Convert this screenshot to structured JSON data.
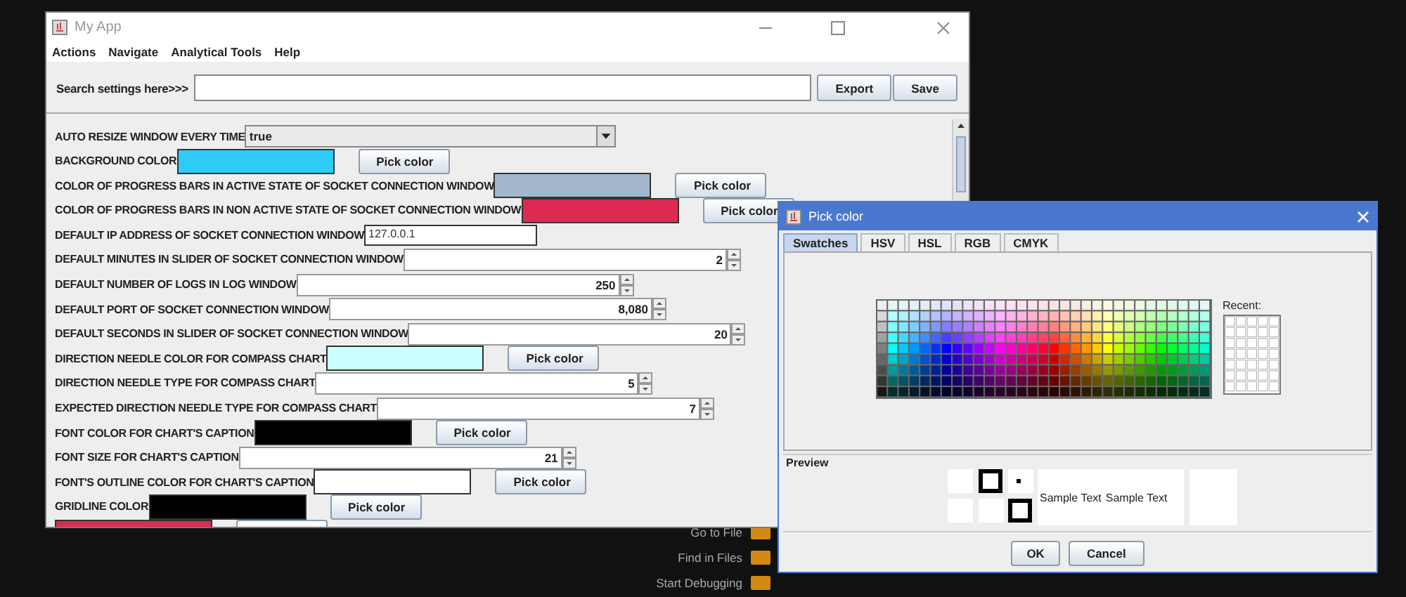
{
  "main_window": {
    "title": "My App",
    "menu": [
      "Actions",
      "Navigate",
      "Analytical Tools",
      "Help"
    ],
    "search_label": "Search settings here>>>",
    "buttons": [
      "Export",
      "Save"
    ],
    "settings": [
      {
        "kind": "combo",
        "label": "AUTO RESIZE WINDOW EVERY TIME",
        "value": "true"
      },
      {
        "kind": "color",
        "label": "BACKGROUND COLOR",
        "color": "#2ecbf7",
        "button": "Pick color"
      },
      {
        "kind": "color",
        "label": "COLOR OF PROGRESS BARS IN ACTIVE STATE OF SOCKET CONNECTION WINDOW",
        "color": "#a3b8cc",
        "button": "Pick color"
      },
      {
        "kind": "color",
        "label": "COLOR OF PROGRESS BARS IN NON ACTIVE STATE OF SOCKET CONNECTION WINDOW",
        "color": "#dc2a50",
        "button": "Pick color"
      },
      {
        "kind": "text",
        "label": "DEFAULT IP ADDRESS OF SOCKET CONNECTION WINDOW",
        "value": "127.0.0.1"
      },
      {
        "kind": "spinner",
        "label": "DEFAULT MINUTES IN SLIDER OF SOCKET CONNECTION WINDOW",
        "value": "2"
      },
      {
        "kind": "spinner",
        "label": "DEFAULT NUMBER OF LOGS IN LOG WINDOW",
        "value": "250"
      },
      {
        "kind": "spinner",
        "label": "DEFAULT PORT OF SOCKET CONNECTION WINDOW",
        "value": "8,080"
      },
      {
        "kind": "spinner",
        "label": "DEFAULT SECONDS IN SLIDER OF SOCKET CONNECTION WINDOW",
        "value": "20"
      },
      {
        "kind": "color",
        "label": "DIRECTION NEEDLE COLOR FOR COMPASS CHART",
        "color": "#ccffff",
        "button": "Pick color"
      },
      {
        "kind": "spinner",
        "label": "DIRECTION NEEDLE TYPE FOR COMPASS CHART",
        "value": "5"
      },
      {
        "kind": "spinner",
        "label": "EXPECTED DIRECTION NEEDLE TYPE FOR COMPASS CHART",
        "value": "7"
      },
      {
        "kind": "color",
        "label": "FONT COLOR FOR CHART'S CAPTION",
        "color": "#000000",
        "button": "Pick color"
      },
      {
        "kind": "spinner",
        "label": "FONT SIZE FOR CHART'S CAPTION",
        "value": "21"
      },
      {
        "kind": "color",
        "label": "FONT'S OUTLINE COLOR FOR CHART'S CAPTION",
        "color": "#ffffff",
        "button": "Pick color"
      },
      {
        "kind": "color",
        "label": "GRIDLINE COLOR",
        "color": "#000000",
        "button": "Pick color"
      },
      {
        "kind": "color",
        "color": "#dc2a50"
      }
    ]
  },
  "shortcuts": [
    {
      "label": "Go to File"
    },
    {
      "label": "Find in Files"
    },
    {
      "label": "Start Debugging"
    }
  ],
  "picker_dialog": {
    "title": "Pick color",
    "tabs": [
      {
        "label": "Swatches",
        "selected": true
      },
      {
        "label": "HSV",
        "selected": false
      },
      {
        "label": "HSL",
        "selected": false
      },
      {
        "label": "RGB",
        "selected": false
      },
      {
        "label": "CMYK",
        "selected": false
      }
    ],
    "recent_label": "Recent:",
    "preview_label": "Preview",
    "sample_texts": [
      "Sample Text",
      "Sample Text"
    ],
    "buttons": [
      "OK",
      "Cancel"
    ]
  }
}
